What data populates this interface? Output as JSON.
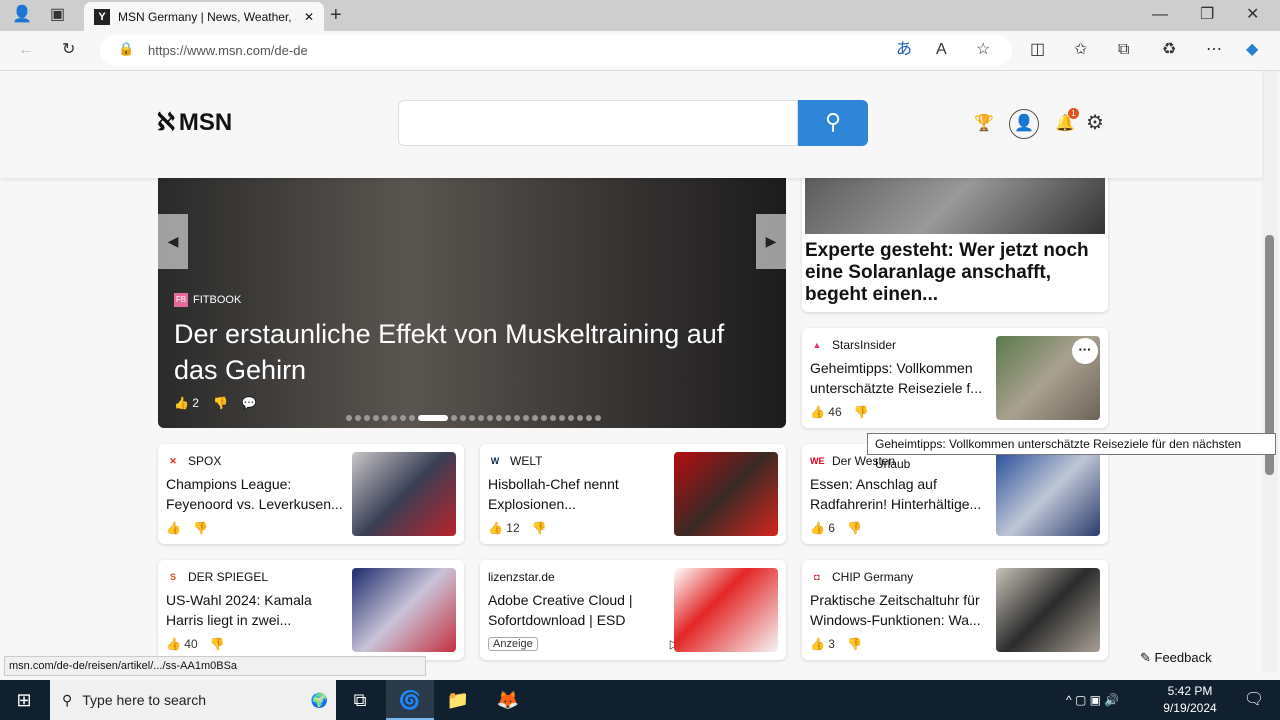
{
  "browser": {
    "tab_title": "MSN Germany | News, Weather, Sport",
    "url": "https://www.msn.com/de-de",
    "status_url": "msn.com/de-de/reisen/artikel/.../ss-AA1m0BSa"
  },
  "header": {
    "logo": "MSN",
    "search_placeholder": "",
    "notification_count": "1"
  },
  "carousel": {
    "source": "FITBOOK",
    "title": "Der erstaunliche Effekt von Muskeltraining auf das Gehirn",
    "likes": "2",
    "dots": 26,
    "active_dot": 8
  },
  "hero_right": {
    "title": "Experte gesteht: Wer jetzt noch eine Solaranlage anschafft, begeht einen..."
  },
  "cards": [
    {
      "source": "StarsInsider",
      "logo": "▲",
      "logo_color": "#e8336b",
      "title": "Geheimtipps: Vollkommen unterschätzte Reiseziele f...",
      "likes": "46",
      "img": "linear-gradient(135deg,#5b7a4a,#a9a090,#6d6458)"
    },
    {
      "source": "SPOX",
      "logo": "✕",
      "logo_color": "#e3262b",
      "title": "Champions League: Feyenoord vs. Leverkusen...",
      "likes": "",
      "img": "linear-gradient(135deg,#c9c6c8,#3a3f55,#b8232c)"
    },
    {
      "source": "WELT",
      "logo": "W",
      "logo_color": "#0e2a4a",
      "title": "Hisbollah-Chef nennt Explosionen...",
      "likes": "12",
      "img": "linear-gradient(135deg,#b50d10,#3a2a25,#d4251d)"
    },
    {
      "source": "Der Westen",
      "logo": "WE",
      "logo_color": "#e3001b",
      "title": "Essen: Anschlag auf Radfahrerin! Hinterhältige...",
      "likes": "6",
      "img": "linear-gradient(135deg,#2a4f9a,#bfc6d6,#2b3c6d)"
    },
    {
      "source": "DER SPIEGEL",
      "logo": "S",
      "logo_color": "#e64415",
      "title": "US-Wahl 2024: Kamala Harris liegt in zwei...",
      "likes": "40",
      "img": "linear-gradient(135deg,#1b2a6a,#c9c4d8,#c43040)"
    },
    {
      "source": "lizenzstar.de",
      "logo": "",
      "logo_color": "#ffffff",
      "title": "Adobe Creative Cloud | Sofortdownload | ESD",
      "likes": "",
      "ad": "Anzeige",
      "img": "linear-gradient(135deg,#fff,#e32626 40%,#f5f5f5)"
    },
    {
      "source": "CHIP Germany",
      "logo": "◘",
      "logo_color": "#d8141f",
      "title": "Praktische Zeitschaltuhr für Windows-Funktionen: Wa...",
      "likes": "3",
      "img": "linear-gradient(135deg,#c8c2b8,#2b2b2b,#a8a095)"
    }
  ],
  "tooltip": "Geheimtipps: Vollkommen unterschätzte Reiseziele für den nächsten Urlaub",
  "feedback": "Feedback",
  "taskbar": {
    "search_placeholder": "Type here to search",
    "time": "5:42 PM",
    "date": "9/19/2024"
  }
}
